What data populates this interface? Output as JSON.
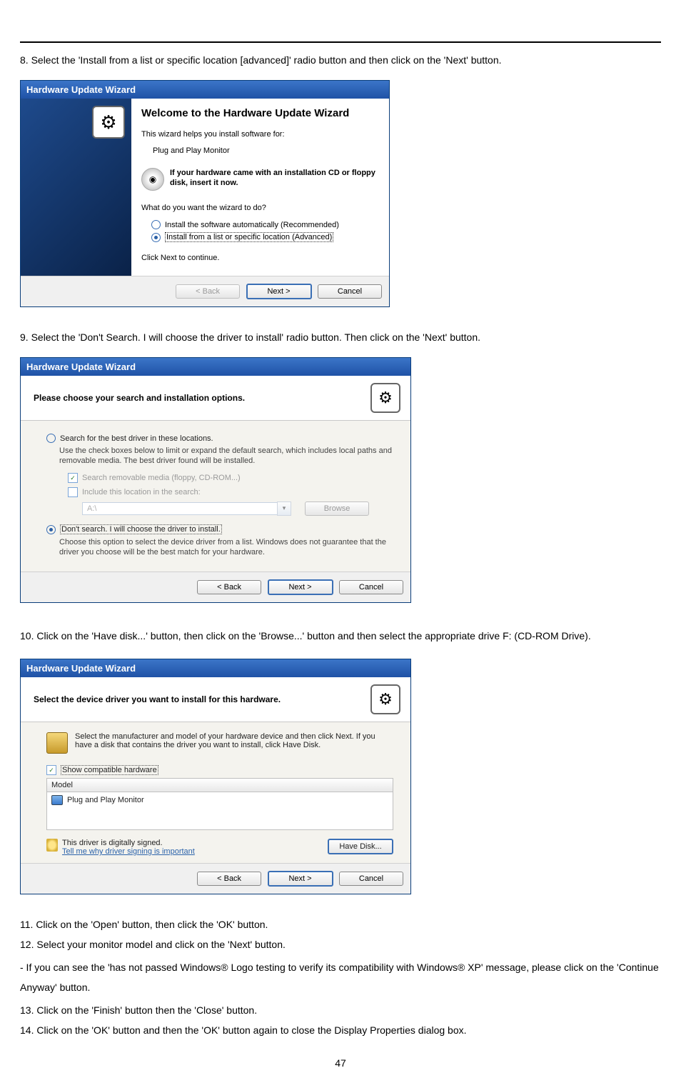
{
  "step8": {
    "instruction": "8. Select the 'Install from a list or specific location [advanced]' radio button and then click on the 'Next' button.",
    "title": "Hardware Update Wizard",
    "welcome": "Welcome to the Hardware Update Wizard",
    "helps": "This wizard helps you install software for:",
    "device": "Plug and Play Monitor",
    "cd_msg": "If your hardware came with an installation CD or floppy disk, insert it now.",
    "what_do": "What do you want the wizard to do?",
    "opt_auto": "Install the software automatically (Recommended)",
    "opt_list": "Install from a list or specific location (Advanced)",
    "click_next": "Click Next to continue.",
    "back": "< Back",
    "next": "Next >",
    "cancel": "Cancel"
  },
  "step9": {
    "instruction": "9. Select the 'Don't Search. I will choose the driver to install' radio button. Then click on the 'Next' button.",
    "title": "Hardware Update Wizard",
    "header": "Please choose your search and installation options.",
    "opt_search": "Search for the best driver in these locations.",
    "search_sub": "Use the check boxes below to limit or expand the default search, which includes local paths and removable media. The best driver found will be installed.",
    "chk_removable": "Search removable media (floppy, CD-ROM...)",
    "chk_include": "Include this location in the search:",
    "path": "A:\\",
    "browse": "Browse",
    "opt_dont": "Don't search. I will choose the driver to install.",
    "dont_sub": "Choose this option to select the device driver from a list.  Windows does not guarantee that the driver you choose will be the best match for your hardware.",
    "back": "< Back",
    "next": "Next >",
    "cancel": "Cancel"
  },
  "step10": {
    "instruction": "10. Click on the 'Have disk...' button, then click on the 'Browse...' button and then select the appropriate drive F: (CD-ROM Drive).",
    "title": "Hardware Update Wizard",
    "header": "Select the device driver you want to install for this hardware.",
    "body_text": "Select the manufacturer and model of your hardware device and then click Next. If you have a disk that contains the driver you want to install, click Have Disk.",
    "show_compat": "Show compatible hardware",
    "model": "Model",
    "pnp": "Plug and Play Monitor",
    "signed": "This driver is digitally signed.",
    "tell_me": "Tell me why driver signing is important",
    "have_disk": "Have Disk...",
    "back": "< Back",
    "next": "Next >",
    "cancel": "Cancel"
  },
  "tail": {
    "s11": "11. Click on the 'Open' button, then click the 'OK' button.",
    "s12": "12. Select your monitor model and click on the 'Next' button.",
    "s12b": "- If you can see the 'has not passed Windows® Logo testing to verify its compatibility with Windows® XP' message, please click on the 'Continue Anyway' button.",
    "s13": "13. Click on the 'Finish' button then the 'Close' button.",
    "s14": "14. Click on the 'OK' button and then the 'OK' button again to close the Display Properties dialog box."
  },
  "page": "47"
}
